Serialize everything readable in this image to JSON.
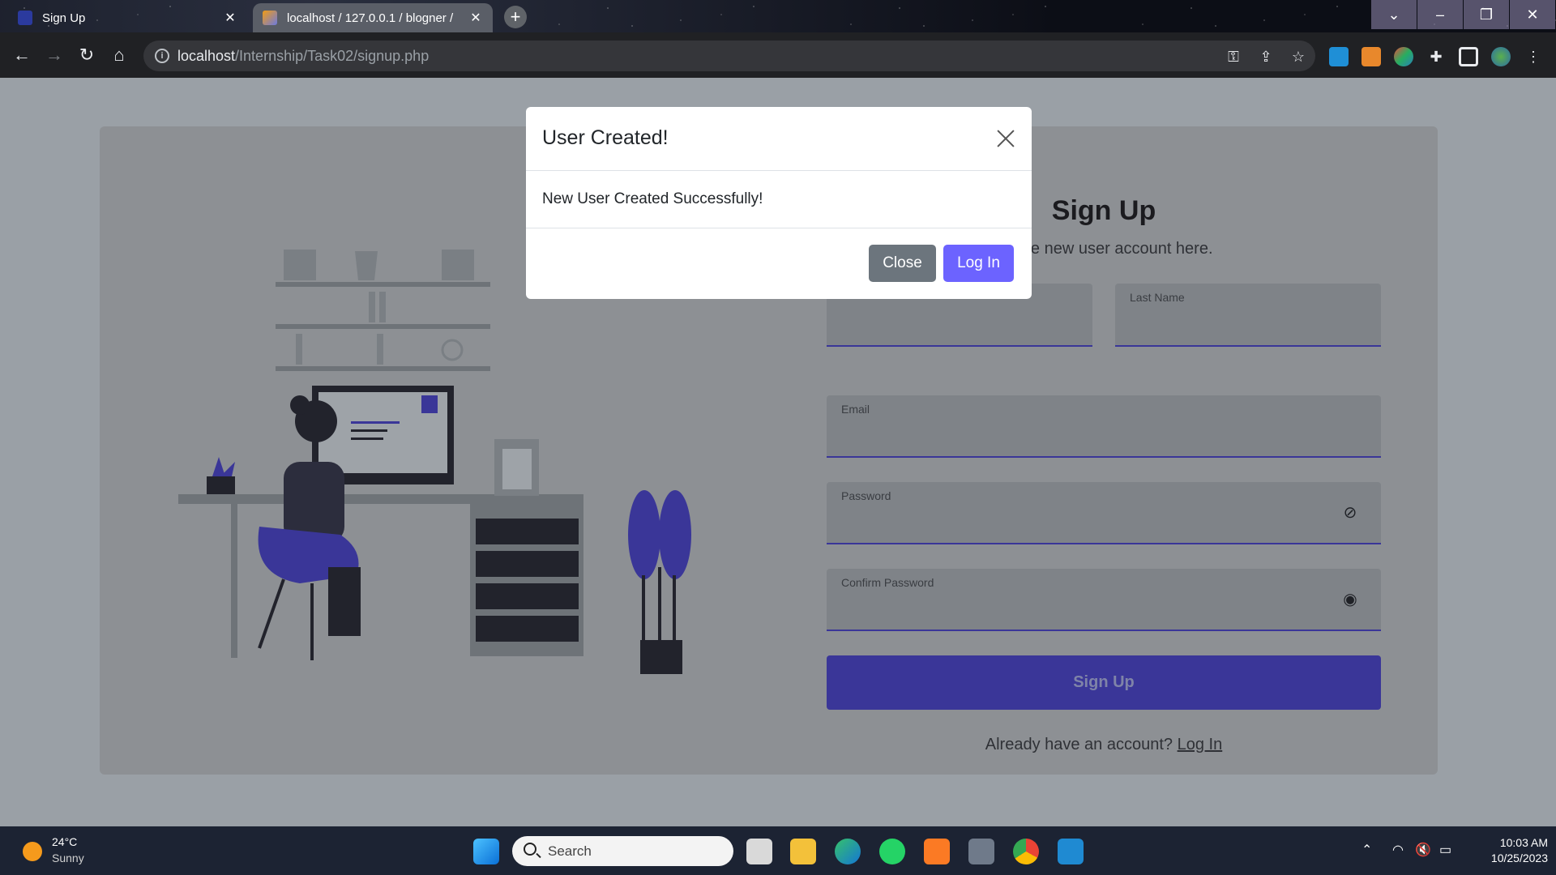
{
  "browser": {
    "tabs": [
      {
        "title": "Sign Up",
        "active": true
      },
      {
        "title": "localhost / 127.0.0.1 / blogner /",
        "active": false
      }
    ],
    "url_host": "localhost",
    "url_path": "/Internship/Task02/signup.php"
  },
  "form": {
    "title": "Sign Up",
    "subtitle": "create new user account here.",
    "last_name_label": "Last Name",
    "email_label": "Email",
    "password_label": "Password",
    "confirm_password_label": "Confirm Password",
    "submit_label": "Sign Up",
    "login_prompt": "Already have an account?",
    "login_link": "Log In"
  },
  "modal": {
    "title": "User Created!",
    "message": "New User Created Successfully!",
    "close_label": "Close",
    "login_label": "Log In"
  },
  "taskbar": {
    "weather_temp": "24°C",
    "weather_cond": "Sunny",
    "search_placeholder": "Search",
    "time": "10:03 AM",
    "date": "10/25/2023"
  },
  "colors": {
    "accent": "#3a3698",
    "modal_login": "#6c63ff",
    "modal_close": "#6c757d"
  }
}
